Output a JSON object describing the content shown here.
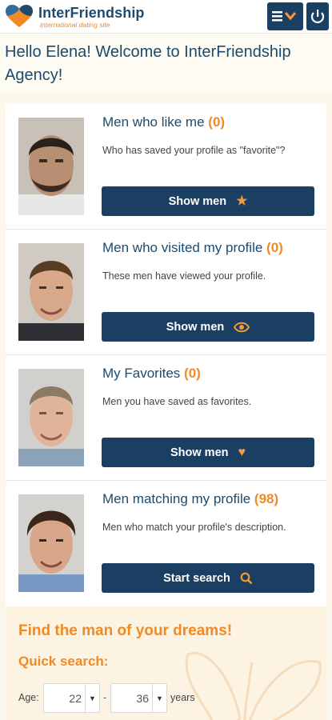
{
  "header": {
    "brand_name": "InterFriendship",
    "tagline": "international dating site",
    "menu_icon": "hamburger-chevron-icon",
    "power_icon": "power-icon"
  },
  "welcome": {
    "text": "Hello Elena! Welcome to InterFriendship Agency!"
  },
  "sections": [
    {
      "title": "Men who like me",
      "count": "(0)",
      "description": "Who has saved your profile as \"favorite\"?",
      "button_label": "Show men",
      "button_icon": "star-icon"
    },
    {
      "title": "Men who visited my profile",
      "count": "(0)",
      "description": "These men have viewed your profile.",
      "button_label": "Show men",
      "button_icon": "eye-icon"
    },
    {
      "title": "My Favorites",
      "count": "(0)",
      "description": "Men you have saved as favorites.",
      "button_label": "Show men",
      "button_icon": "heart-icon"
    },
    {
      "title": "Men matching my profile",
      "count": "(98)",
      "description": "Men who match your profile's description.",
      "button_label": "Start search",
      "button_icon": "search-icon"
    }
  ],
  "quick_search": {
    "heading": "Find the man of your dreams!",
    "subheading": "Quick search:",
    "age_label": "Age:",
    "age_from": "22",
    "separator": "-",
    "age_to": "36",
    "years_label": "years"
  },
  "colors": {
    "navy": "#1a3f63",
    "orange": "#f08a24",
    "text_blue": "#1d4a6d"
  }
}
